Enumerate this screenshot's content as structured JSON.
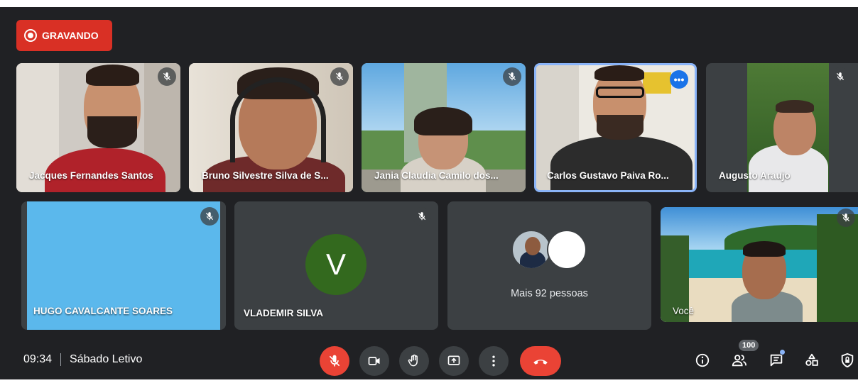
{
  "recording": {
    "label": "GRAVANDO"
  },
  "participants_row1": [
    {
      "name": "Jacques Fernandes Santos"
    },
    {
      "name": "Bruno Silvestre Silva de S..."
    },
    {
      "name": "Jania Claudia Camilo dos..."
    },
    {
      "name": "Carlos Gustavo Paiva Ro..."
    },
    {
      "name": "Augusto Araujo"
    }
  ],
  "participants_row2": [
    {
      "name": "HUGO CAVALCANTE SOARES"
    },
    {
      "name": "VLADEMIR SILVA",
      "initial": "V"
    },
    {
      "name": "Mais 92 pessoas"
    },
    {
      "name": "Você"
    }
  ],
  "bottom_bar": {
    "time": "09:34",
    "meeting_title": "Sábado Letivo",
    "participant_count": "100"
  },
  "colors": {
    "background": "#202124",
    "record_red": "#d93025",
    "hangup_red": "#ea4335",
    "active_border": "#8ab4f8",
    "hugo_tile": "#5bb8ec",
    "vlademir_avatar": "#33691e"
  },
  "icons": [
    "record-icon",
    "mic-off-icon",
    "more-options-icon",
    "camera-icon",
    "raise-hand-icon",
    "present-icon",
    "more-vert-icon",
    "hangup-icon",
    "info-icon",
    "people-icon",
    "chat-icon",
    "activities-icon",
    "host-controls-icon"
  ]
}
